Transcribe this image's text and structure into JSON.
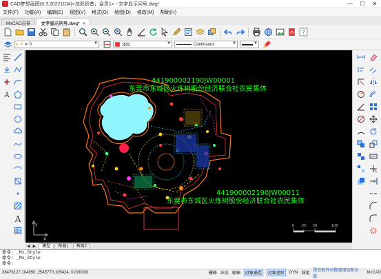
{
  "window": {
    "title": "CAD梦想画图(6.3.20221104)<炫彩奶昔，会员1> - 文字显示问号.dwg*",
    "minimize": "—",
    "maximize": "☐",
    "close": "✕"
  },
  "menu": [
    "文件(F)",
    "功能(A)",
    "编辑(E)",
    "视图(V)",
    "格式(O)",
    "绘图(D)",
    "修改(M)",
    "帮助(H)"
  ],
  "tabs": [
    {
      "label": "MxCAD云参",
      "active": false
    },
    {
      "label": "文字显示问号.dwg*",
      "active": true
    }
  ],
  "toolbar2": {
    "layer_value": "0",
    "color_value": "洋红",
    "linetype_value": "Continuous"
  },
  "canvas": {
    "label_top_code": "441900002190JW00001",
    "label_top_name": "东莞市东城区火炼树股份经济联合社农民集体",
    "label_bottom_code": "441900002190JW00011",
    "label_bottom_name": "东莞市东城区火炼树股份经济联合社农民集体",
    "label_color": "#17ff17",
    "background": "#000000",
    "ucs_x": "X",
    "ucs_y": "Y",
    "scale_ticks": [
      "0",
      "25",
      "50",
      "100"
    ]
  },
  "layout_tabs": [
    "模型",
    "布局1",
    "布局2"
  ],
  "command_lines": [
    "命令: _Mx_Style",
    "命令: _Mx_Style",
    "命令:"
  ],
  "status": {
    "coords": "38476127.104950,  2545770.105424,  0.000000",
    "toggles": [
      {
        "label": "栅格",
        "on": false
      },
      {
        "label": "正交",
        "on": false
      },
      {
        "label": "极轴",
        "on": false
      },
      {
        "label": "对象捕捉",
        "on": true
      },
      {
        "label": "对象追踪",
        "on": true
      },
      {
        "label": "DYN",
        "on": false
      },
      {
        "label": "线宽",
        "on": false
      }
    ],
    "link": "提交软件问题或增加新功能",
    "brand": "MxCAD"
  }
}
